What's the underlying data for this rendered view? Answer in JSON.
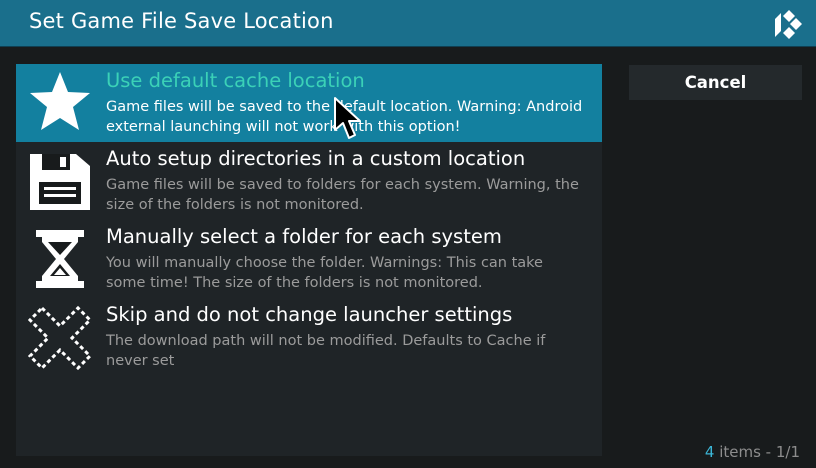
{
  "dialog": {
    "title": "Set Game File Save Location",
    "logo_icon": "kodi-logo-icon"
  },
  "options": [
    {
      "icon": "star-icon",
      "label": "Use default cache location",
      "description": "Game files will be saved to the default location. Warning: Android external launching will not work with this option!",
      "selected": true
    },
    {
      "icon": "floppy-disk-icon",
      "label": "Auto setup directories in a custom location",
      "description": "Game files will be saved to folders for each system. Warning, the size of the folders is not monitored.",
      "selected": false
    },
    {
      "icon": "hourglass-icon",
      "label": "Manually select a folder for each system",
      "description": "You will manually choose the folder. Warnings: This can take some time! The size of the folders is not monitored.",
      "selected": false
    },
    {
      "icon": "cross-icon",
      "label": "Skip and do not change launcher settings",
      "description": "The download path will not be modified.  Defaults to Cache if never set",
      "selected": false
    }
  ],
  "buttons": {
    "cancel": "Cancel"
  },
  "footer": {
    "count": "4",
    "items_text": " items - ",
    "page": "1/1"
  },
  "colors": {
    "accent": "#13809f",
    "title_bar": "#1a6f8c",
    "selected_label": "#3bd1b7",
    "background": "#181b1c"
  }
}
